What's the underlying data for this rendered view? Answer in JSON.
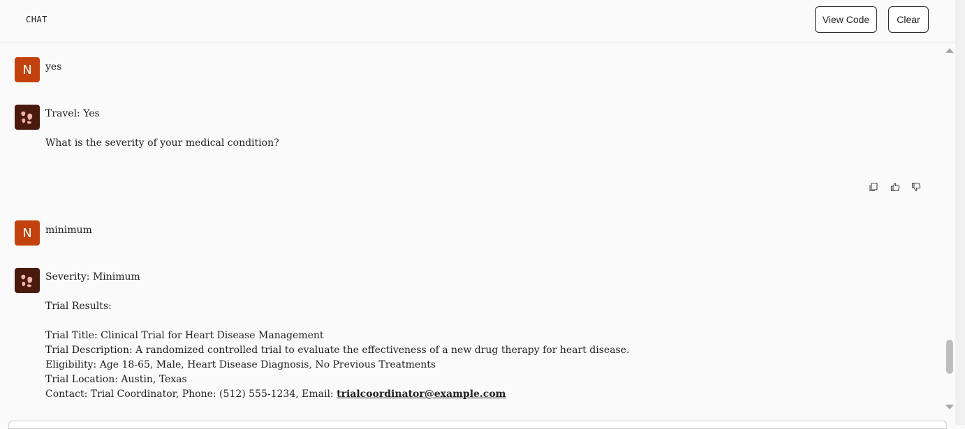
{
  "header": {
    "title": "CHAT",
    "view_code_label": "View Code",
    "clear_label": "Clear"
  },
  "messages": [
    {
      "role": "user",
      "avatar": "N",
      "text": "yes"
    },
    {
      "role": "assistant",
      "avatar_icon": "bot-logo-icon",
      "lines": [
        "Travel: Yes",
        "",
        "What is the severity of your medical condition?"
      ]
    },
    {
      "role": "user",
      "avatar": "N",
      "text": "minimum"
    },
    {
      "role": "assistant",
      "avatar_icon": "bot-logo-icon",
      "heading": "Severity: Minimum",
      "results_label": "Trial Results:",
      "title_line": "Trial Title: Clinical Trial for Heart Disease Management",
      "description_line": "Trial Description: A randomized controlled trial to evaluate the effectiveness of a new drug therapy for heart disease.",
      "eligibility_line": "Eligibility: Age 18-65, Male, Heart Disease Diagnosis, No Previous Treatments",
      "location_line": "Trial Location: Austin, Texas",
      "contact_prefix": "Contact: Trial Coordinator, Phone: (512) 555-1234, Email: ",
      "contact_email": "trialcoordinator@example.com"
    }
  ],
  "actions": {
    "copy_icon": "copy-icon",
    "like_icon": "thumbs-up-icon",
    "dislike_icon": "thumbs-down-icon"
  },
  "colors": {
    "user_avatar": "#c2410c",
    "bot_avatar": "#4a1a0f",
    "background": "#fafafa"
  }
}
